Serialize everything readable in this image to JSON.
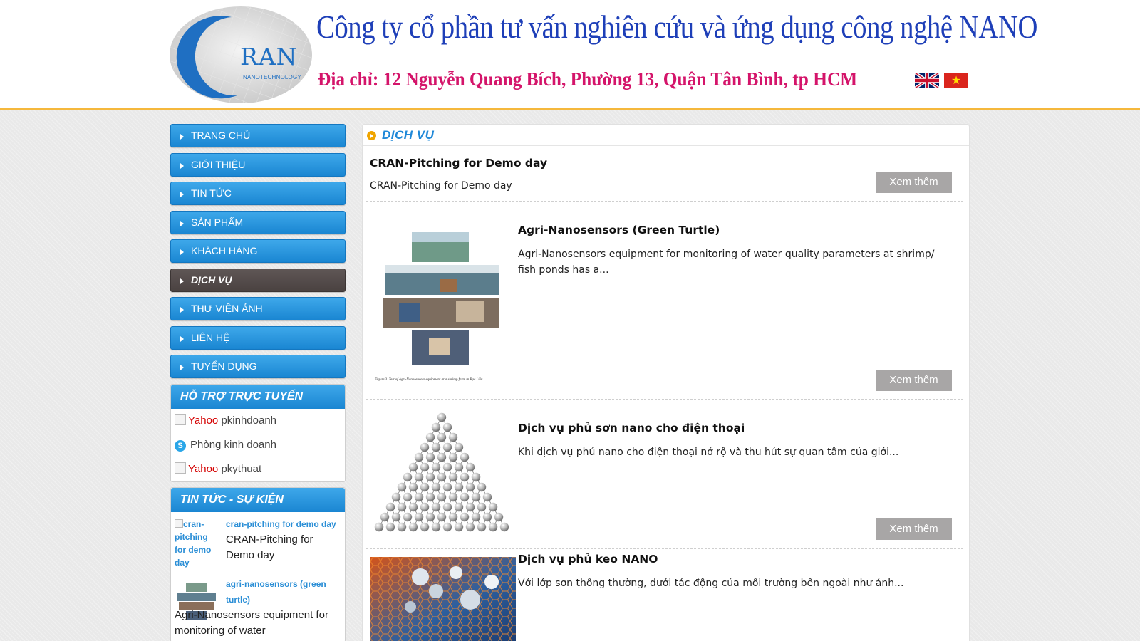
{
  "header": {
    "logo_text": "RAN",
    "logo_subtext": "NANOTECHNOLOGY",
    "company_name": "Công ty cổ phần tư vấn nghiên cứu và ứng dụng công nghệ NANO",
    "address": "Địa chỉ: 12 Nguyễn Quang Bích, Phường 13, Quận Tân Bình, tp HCM",
    "flags": [
      "english-flag",
      "vietnam-flag"
    ],
    "vn_star": "★"
  },
  "menu": [
    {
      "label": "TRANG CHỦ"
    },
    {
      "label": "GIỚI THIỆU"
    },
    {
      "label": "TIN TỨC"
    },
    {
      "label": "SẢN PHẨM"
    },
    {
      "label": "KHÁCH HÀNG"
    },
    {
      "label": "DỊCH VỤ",
      "active": true
    },
    {
      "label": "THƯ VIỆN ẢNH"
    },
    {
      "label": "LIÊN HỆ"
    },
    {
      "label": "TUYỂN DỤNG"
    }
  ],
  "support": {
    "title": "HỖ TRỢ TRỰC TUYẾN",
    "items": [
      {
        "icon_alt": "Yahoo",
        "label": "pkinhdoanh"
      },
      {
        "icon": "S",
        "label": "Phòng kinh doanh"
      },
      {
        "icon_alt": "Yahoo",
        "label": "pkythuat"
      }
    ]
  },
  "news": {
    "title": "TIN TỨC - SỰ KIỆN",
    "items": [
      {
        "thumb_alt": "cran-pitching for demo day",
        "link": "cran-pitching for demo day",
        "desc": "CRAN-Pitching for Demo day"
      },
      {
        "link": "agri-nanosensors (green turtle)",
        "desc": "Agri-Nanosensors equipment for monitoring of water"
      }
    ]
  },
  "main": {
    "section_title": "DỊCH VỤ",
    "more_label": "Xem thêm",
    "services": [
      {
        "title": "CRAN-Pitching for Demo day",
        "desc": "CRAN-Pitching for Demo day"
      },
      {
        "title": "Agri-Nanosensors (Green Turtle)",
        "desc": "Agri-Nanosensors equipment for monitoring of water quality parameters at shrimp/ fish ponds has a...",
        "caption": "Figure 3. Test of Agri-Nanosensors equipment at a shrimp farm in Bạc Liêu."
      },
      {
        "title": "Dịch vụ phủ sơn nano cho điện thoại",
        "desc": "Khi dịch vụ phủ nano cho điện thoại nở rộ và thu hút sự quan tâm của giới..."
      },
      {
        "title": "Dịch vụ phủ keo NANO",
        "desc": "Với lớp sơn thông thường, dưới tác động của môi trường bên ngoài như ánh..."
      }
    ]
  }
}
